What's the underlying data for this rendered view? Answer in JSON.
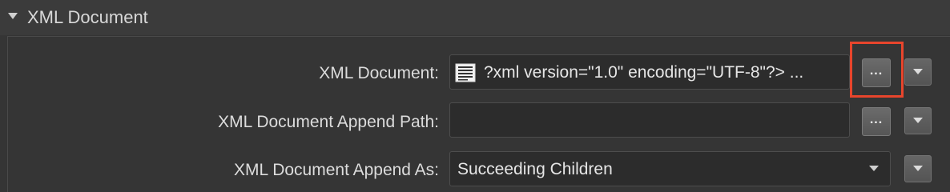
{
  "section": {
    "title": "XML Document",
    "toggle_icon": "triangle-down-icon"
  },
  "rows": [
    {
      "label": "XML Document:",
      "value": "?xml version=\"1.0\" encoding=\"UTF-8\"?> ...",
      "value_icon": "document-text-icon",
      "ellipsis_label": "...",
      "menu_icon": "triangle-down-icon"
    },
    {
      "label": "XML Document Append Path:",
      "value": "",
      "ellipsis_label": "...",
      "menu_icon": "triangle-down-icon"
    },
    {
      "label": "XML Document Append As:",
      "value": "Succeeding Children",
      "dropdown_icon": "chevron-down-icon",
      "menu_icon": "triangle-down-icon"
    }
  ],
  "highlight_color": "#e8452c"
}
